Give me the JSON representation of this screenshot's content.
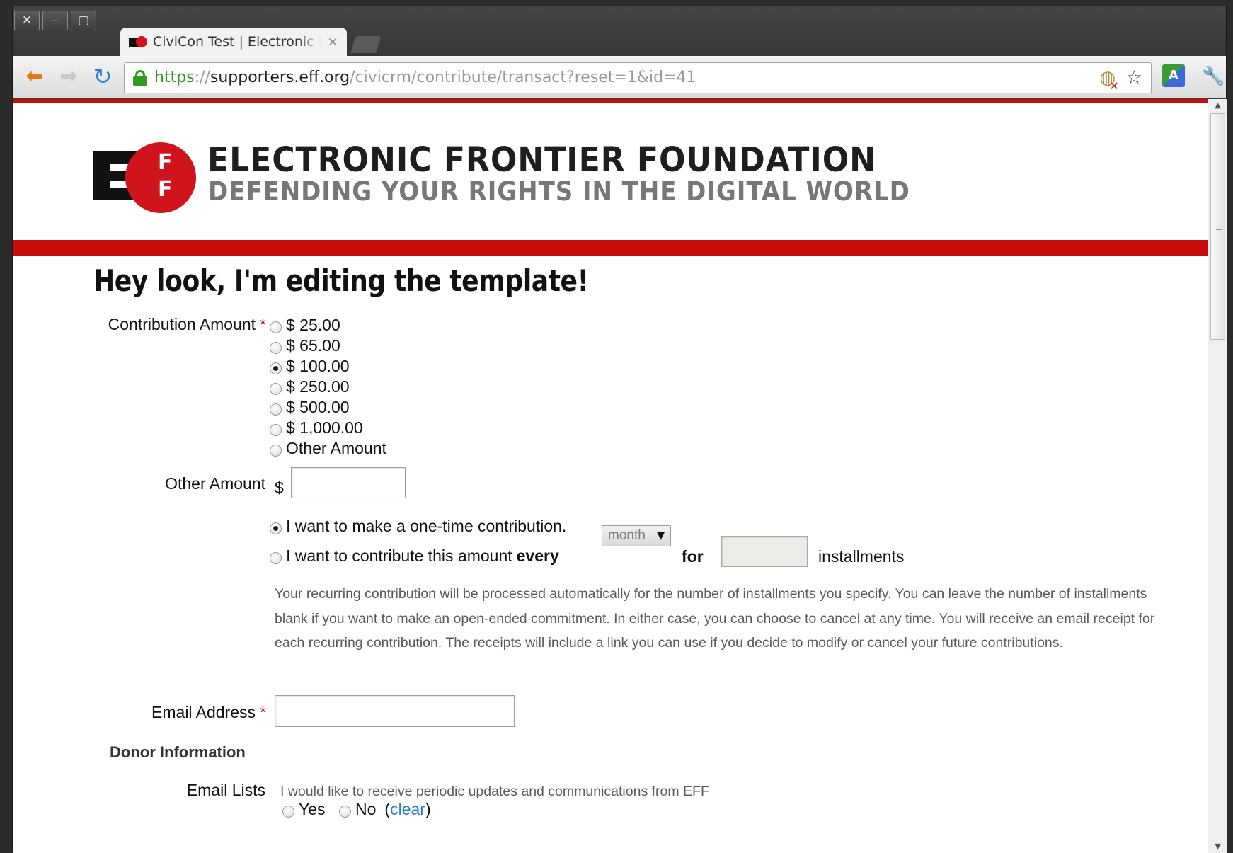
{
  "browser": {
    "window_buttons": {
      "close": "✕",
      "minimize": "–",
      "maximize": "▢"
    },
    "tab": {
      "title": "CiviCon Test | Electronic Frontier Foundation",
      "close": "×"
    },
    "url": {
      "scheme": "https",
      "separator": "://",
      "host": "supporters.eff.org",
      "path": "/civicrm/contribute/transact?reset=1&id=41"
    },
    "icons": {
      "back": "back-arrow-icon",
      "forward": "forward-arrow-icon",
      "reload": "reload-icon",
      "lock": "lock-icon",
      "cookie_blocked": "cookie-blocked-icon",
      "bookmark": "star-icon",
      "translate": "translate-icon",
      "settings": "wrench-icon"
    },
    "translate_glyph": "A"
  },
  "header": {
    "logo_letters": "F",
    "org_name": "ELECTRONIC FRONTIER FOUNDATION",
    "tagline": "DEFENDING YOUR RIGHTS IN THE DIGITAL WORLD"
  },
  "form": {
    "page_title": "Hey look, I'm editing the template!",
    "contribution_amount": {
      "label": "Contribution Amount",
      "required_mark": "*",
      "options": [
        {
          "label": "$ 25.00",
          "checked": false
        },
        {
          "label": "$ 65.00",
          "checked": false
        },
        {
          "label": "$ 100.00",
          "checked": true
        },
        {
          "label": "$ 250.00",
          "checked": false
        },
        {
          "label": "$ 500.00",
          "checked": false
        },
        {
          "label": "$ 1,000.00",
          "checked": false
        },
        {
          "label": "Other Amount",
          "checked": false
        }
      ]
    },
    "other_amount": {
      "label": "Other Amount",
      "currency": "$",
      "value": ""
    },
    "frequency": {
      "one_time_label": "I want to make a one-time contribution.",
      "one_time_checked": true,
      "recurring_prefix": "I want to contribute this amount",
      "recurring_every": "every",
      "recurring_checked": false,
      "unit_selected": "month",
      "for_label": "for",
      "installments_value": "",
      "installments_label": "installments"
    },
    "recurring_help": "Your recurring contribution will be processed automatically for the number of installments you specify. You can leave the number of installments blank if you want to make an open-ended commitment. In either case, you can choose to cancel at any time. You will receive an email receipt for each recurring contribution. The receipts will include a link you can use if you decide to modify or cancel your future contributions.",
    "email": {
      "label": "Email Address",
      "required_mark": "*",
      "value": ""
    },
    "donor_section": "Donor Information",
    "email_lists": {
      "label": "Email Lists",
      "description": "I would like to receive periodic updates and communications from EFF",
      "yes": "Yes",
      "no": "No",
      "clear_open": "(",
      "clear_link": "clear",
      "clear_close": ")"
    }
  }
}
